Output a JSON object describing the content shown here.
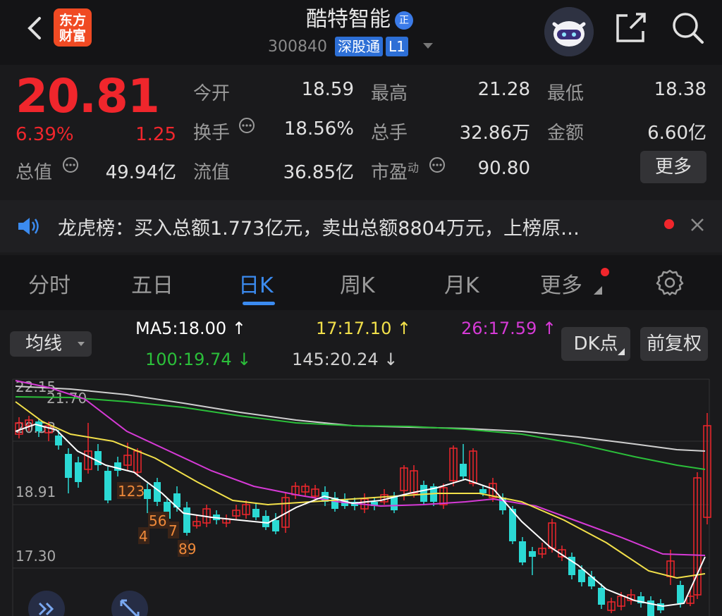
{
  "header": {
    "logo_line1": "东方",
    "logo_line2": "财富",
    "stock_name": "酷特智能",
    "name_badge": "正",
    "stock_code": "300840",
    "tag_connect": "深股通",
    "tag_level": "L1"
  },
  "quote": {
    "price": "20.81",
    "change_pct": "6.39%",
    "change_amt": "1.25",
    "open_label": "今开",
    "open_value": "18.59",
    "high_label": "最高",
    "high_value": "21.28",
    "low_label": "最低",
    "low_value": "18.38",
    "turnover_label": "换手",
    "turnover_value": "18.56%",
    "volume_label": "总手",
    "volume_value": "32.86万",
    "amount_label": "金额",
    "amount_value": "6.60亿",
    "mktcap_label": "总值",
    "mktcap_value": "49.94亿",
    "float_label": "流值",
    "float_value": "36.85亿",
    "pe_label": "市盈",
    "pe_sup": "动",
    "pe_value": "90.80",
    "more_label": "更多"
  },
  "notice": {
    "text": "龙虎榜：买入总额1.773亿元，卖出总额8804万元，上榜原…"
  },
  "tabs": [
    {
      "label": "分时"
    },
    {
      "label": "五日"
    },
    {
      "label": "日K"
    },
    {
      "label": "周K"
    },
    {
      "label": "月K"
    },
    {
      "label": "更多"
    }
  ],
  "indicators": {
    "selector_label": "均线",
    "ma5": "MA5:18.00",
    "ma17": "17:17.10",
    "ma26": "26:17.59",
    "ma100": "100:19.74",
    "ma145": "145:20.24",
    "dk_label": "DK点",
    "adjust_label": "前复权"
  },
  "chart_labels": {
    "y_top": "22.15",
    "y_hi": "21.70",
    "y_mid1": "20.53",
    "y_mid2": "18.91",
    "y_low": "17.30",
    "seq_123": "123",
    "seq_4": "4",
    "seq_56": "56",
    "seq_7": "7",
    "seq_89": "89"
  },
  "colors": {
    "up": "#f0262c",
    "down": "#2bd9d4",
    "ma5": "#ffffff",
    "ma17": "#f2e04a",
    "ma26": "#d63ad6",
    "ma100": "#2bbf3a",
    "ma145": "#cfcfcf",
    "accent": "#3b8bf0"
  }
}
